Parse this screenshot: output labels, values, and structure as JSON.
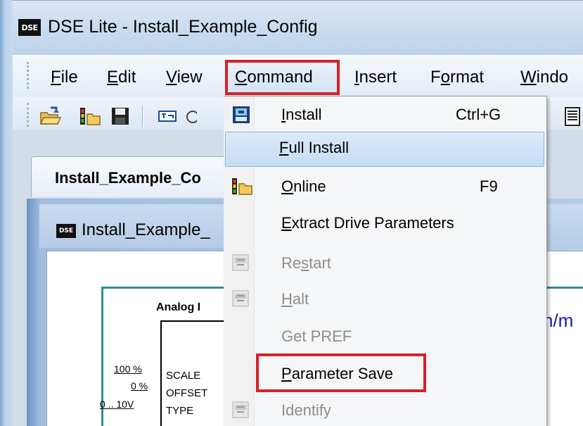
{
  "window": {
    "app_icon_text": "DSE",
    "title": "DSE Lite - Install_Example_Config"
  },
  "menubar": {
    "items": [
      {
        "label": "File",
        "mnemonic": "F",
        "rest": "ile"
      },
      {
        "label": "Edit",
        "mnemonic": "E",
        "rest": "dit"
      },
      {
        "label": "View",
        "mnemonic": "V",
        "rest": "iew"
      },
      {
        "label": "Command",
        "mnemonic": "C",
        "rest": "ommand"
      },
      {
        "label": "Insert",
        "mnemonic": "I",
        "rest": "nsert"
      },
      {
        "label": "Format",
        "pre": "F",
        "mnemonic": "o",
        "rest": "rmat"
      },
      {
        "label": "Windo",
        "mnemonic": "W",
        "rest": "indo"
      }
    ]
  },
  "toolbar": {
    "icons": [
      "open-folder-icon",
      "online-icon",
      "save-icon",
      "install-icon",
      "document-icon"
    ]
  },
  "document_tab": {
    "label": "Install_Example_Co"
  },
  "inner_window": {
    "icon_text": "DSE",
    "title": "Install_Example_"
  },
  "diagram": {
    "block_title": "Analog I",
    "pins": [
      {
        "value": "100 %",
        "label": "SCALE"
      },
      {
        "value": "0 %",
        "label": "OFFSET"
      },
      {
        "value": "0 .. 10V",
        "label": "TYPE"
      }
    ],
    "link_text": "n/m"
  },
  "command_menu": {
    "items": [
      {
        "label_mnemonic": "I",
        "label_rest": "nstall",
        "shortcut": "Ctrl+G",
        "enabled": true,
        "icon": "install-icon"
      },
      {
        "label_mnemonic": "F",
        "label_rest": "ull Install",
        "shortcut": "",
        "enabled": true,
        "icon": ""
      },
      {
        "label_mnemonic": "O",
        "label_rest": "nline",
        "shortcut": "F9",
        "enabled": true,
        "icon": "online-icon"
      },
      {
        "label_mnemonic": "E",
        "label_rest": "xtract Drive Parameters",
        "shortcut": "",
        "enabled": true,
        "icon": ""
      },
      {
        "label_pre": "Re",
        "label_mnemonic": "s",
        "label_rest": "tart",
        "shortcut": "",
        "enabled": false,
        "icon": "restart-icon"
      },
      {
        "label_mnemonic": "H",
        "label_rest": "alt",
        "shortcut": "",
        "enabled": false,
        "icon": "halt-icon"
      },
      {
        "label_mnemonic": "",
        "label_rest": "Get PREF",
        "shortcut": "",
        "enabled": false,
        "icon": ""
      },
      {
        "label_mnemonic": "P",
        "label_rest": "arameter Save",
        "shortcut": "",
        "enabled": true,
        "icon": ""
      },
      {
        "label_mnemonic": "",
        "label_rest": "Identify",
        "shortcut": "",
        "enabled": false,
        "icon": "identify-icon"
      }
    ]
  },
  "colors": {
    "highlight_red": "#d62129",
    "hover_blue": "#c5dcf5",
    "disabled_text": "#8d8d8d"
  }
}
